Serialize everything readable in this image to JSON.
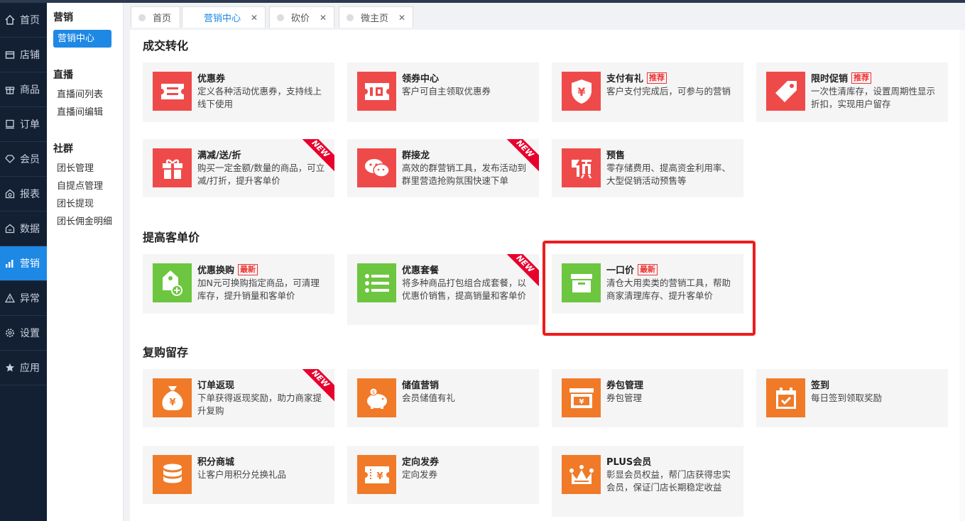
{
  "nav": {
    "items": [
      {
        "label": "首页",
        "icon": "home-icon",
        "active": false
      },
      {
        "label": "店铺",
        "icon": "store-icon",
        "active": false
      },
      {
        "label": "商品",
        "icon": "gift-icon",
        "active": false
      },
      {
        "label": "订单",
        "icon": "order-icon",
        "active": false
      },
      {
        "label": "会员",
        "icon": "member-icon",
        "active": false
      },
      {
        "label": "报表",
        "icon": "report-icon",
        "active": false
      },
      {
        "label": "数据",
        "icon": "data-icon",
        "active": false
      },
      {
        "label": "营销",
        "icon": "chart-icon",
        "active": true
      },
      {
        "label": "异常",
        "icon": "warning-icon",
        "active": false
      },
      {
        "label": "设置",
        "icon": "gear-icon",
        "active": false
      },
      {
        "label": "应用",
        "icon": "star-icon",
        "active": false
      }
    ]
  },
  "subnav": {
    "marketing": {
      "title": "营销",
      "items": [
        "营销中心"
      ]
    },
    "live": {
      "title": "直播",
      "items": [
        "直播间列表",
        "直播间编辑"
      ]
    },
    "community": {
      "title": "社群",
      "items": [
        "团长管理",
        "自提点管理",
        "团长提现",
        "团长佣金明细"
      ]
    }
  },
  "tabs": [
    {
      "label": "首页"
    },
    {
      "label": "营销中心"
    },
    {
      "label": "砍价"
    },
    {
      "label": "微主页"
    }
  ],
  "sections": {
    "s1": "成交转化",
    "s2": "提高客单价",
    "s3": "复购留存"
  },
  "badges": {
    "recommend": "推荐",
    "latest": "最新",
    "new": "NEW"
  },
  "cards": {
    "coupon": {
      "title": "优惠券",
      "desc": "定义各种活动优惠券，支持线上线下使用"
    },
    "coupon_center": {
      "title": "领券中心",
      "desc": "客户可自主领取优惠券"
    },
    "pay_gift": {
      "title": "支付有礼",
      "desc": "客户支付完成后，可参与的营销"
    },
    "flash_sale": {
      "title": "限时促销",
      "desc": "一次性清库存，设置周期性显示折扣，实现用户留存"
    },
    "full_reduce": {
      "title": "满减/送/折",
      "desc": "购买一定金额/数量的商品，可立减/打折，提升客单价"
    },
    "group_chain": {
      "title": "群接龙",
      "desc": "高效的群营销工具，发布活动到群里营造抢购氛围快速下单"
    },
    "presale": {
      "title": "预售",
      "desc": "零存储费用、提高资金利用率、大型促销活动预售等"
    },
    "exchange": {
      "title": "优惠换购",
      "desc": "加N元可换购指定商品，可清理库存，提升销量和客单价"
    },
    "package": {
      "title": "优惠套餐",
      "desc": "将多种商品打包组合成套餐，以优惠价销售，提高销量和客单价"
    },
    "fixed_price": {
      "title": "一口价",
      "desc": "清仓大用卖类的营销工具，帮助商家清理库存、提升客单价"
    },
    "cashback": {
      "title": "订单返现",
      "desc": "下单获得返现奖励，助力商家提升复购"
    },
    "stored_value": {
      "title": "储值营销",
      "desc": "会员储值有礼"
    },
    "coupon_pack": {
      "title": "券包管理",
      "desc": "券包管理"
    },
    "checkin": {
      "title": "签到",
      "desc": "每日签到领取奖励"
    },
    "points_mall": {
      "title": "积分商城",
      "desc": "让客户用积分兑换礼品"
    },
    "targeted_coupon": {
      "title": "定向发券",
      "desc": "定向发券"
    },
    "plus_member": {
      "title": "PLUS会员",
      "desc": "彰显会员权益，帮门店获得忠实会员，保证门店长期稳定收益"
    }
  },
  "colors": {
    "red": "#ef4a4a",
    "green": "#6cc63f",
    "orange": "#f07a28",
    "accent": "#1e88e5",
    "highlight": "#ee1c1c"
  }
}
